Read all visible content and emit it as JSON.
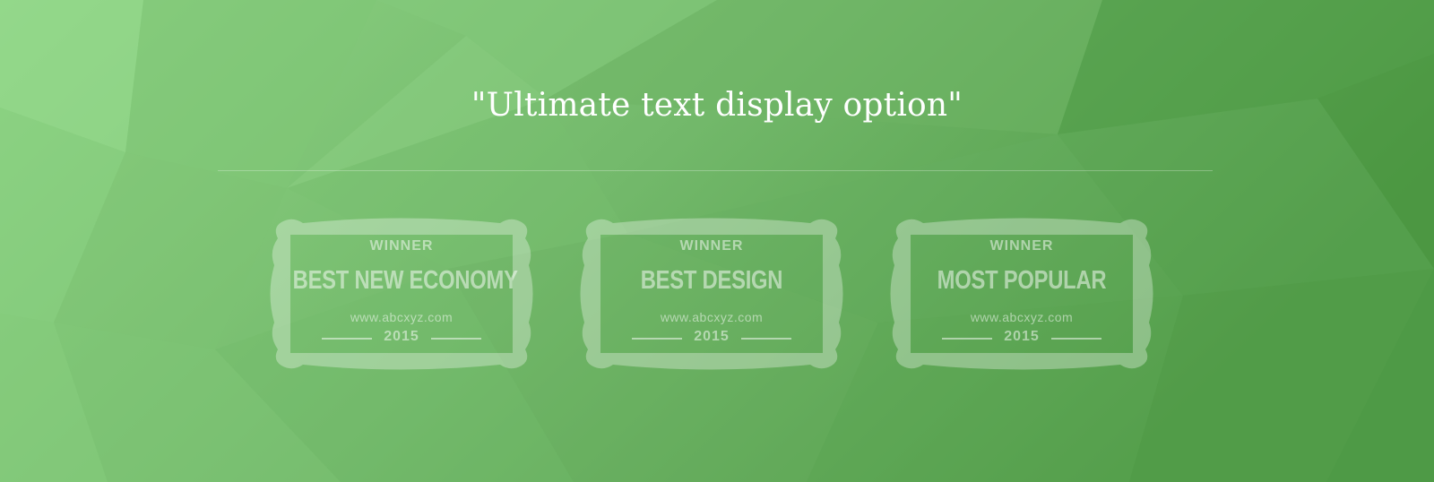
{
  "headline": "\"Ultimate text display option\"",
  "badges": [
    {
      "winner": "WINNER",
      "title": "BEST NEW ECONOMY",
      "url": "www.abcxyz.com",
      "year": "2015"
    },
    {
      "winner": "WINNER",
      "title": "BEST DESIGN",
      "url": "www.abcxyz.com",
      "year": "2015"
    },
    {
      "winner": "WINNER",
      "title": "MOST POPULAR",
      "url": "www.abcxyz.com",
      "year": "2015"
    }
  ],
  "colors": {
    "background_light": "#92d98a",
    "background_mid": "#72b868",
    "background_dark": "#4f9a45",
    "text": "#ffffff"
  }
}
